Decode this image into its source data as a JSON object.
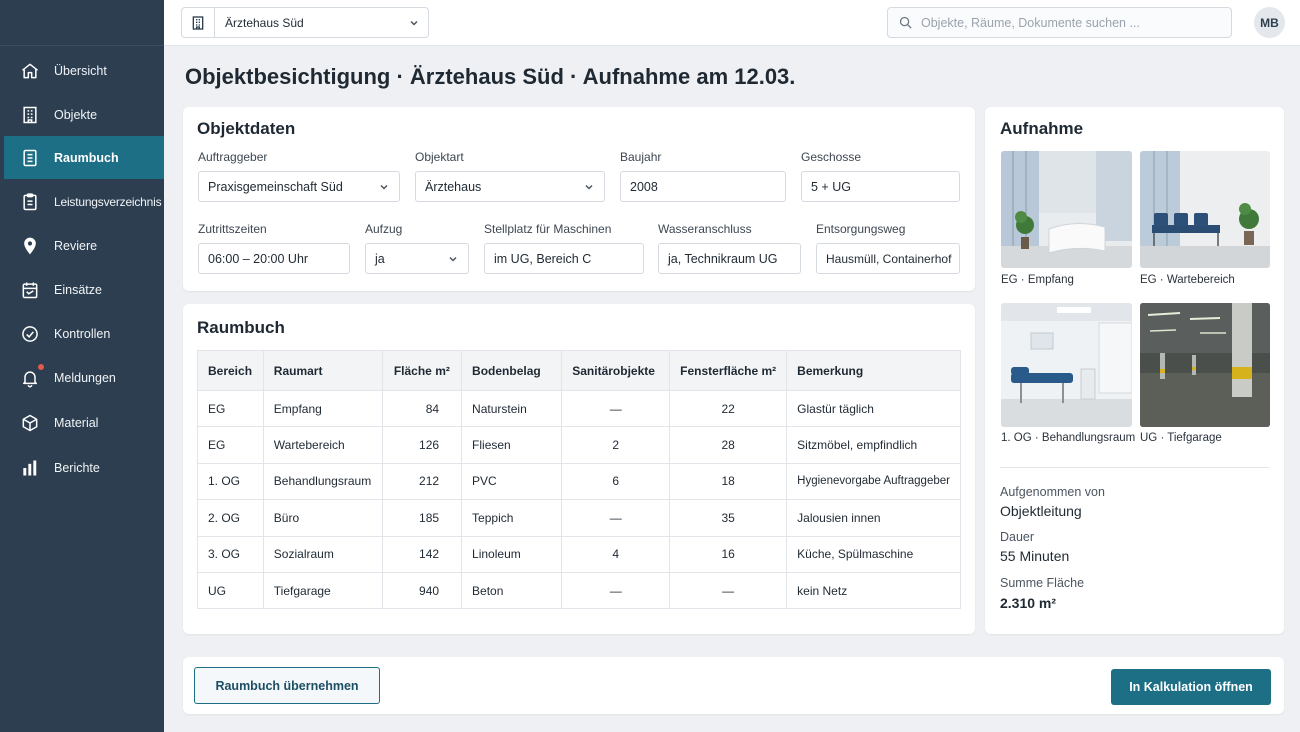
{
  "topbar": {
    "object_select": "Ärztehaus Süd",
    "search_placeholder": "Objekte, Räume, Dokumente suchen ...",
    "avatar": "MB"
  },
  "sidebar": {
    "items": [
      {
        "label": "Übersicht",
        "icon": "home-icon"
      },
      {
        "label": "Objekte",
        "icon": "building-icon"
      },
      {
        "label": "Raumbuch",
        "icon": "document-icon",
        "active": true
      },
      {
        "label": "Leistungsverzeichnis",
        "icon": "clipboard-icon"
      },
      {
        "label": "Reviere",
        "icon": "map-pin-icon"
      },
      {
        "label": "Einsätze",
        "icon": "calendar-icon"
      },
      {
        "label": "Kontrollen",
        "icon": "check-circle-icon"
      },
      {
        "label": "Meldungen",
        "icon": "bell-icon"
      },
      {
        "label": "Material",
        "icon": "box-icon"
      },
      {
        "label": "Berichte",
        "icon": "bar-chart-icon"
      }
    ]
  },
  "page_title": "Objektbesichtigung · Ärztehaus Süd · Aufnahme am 12.03.",
  "objektdaten": {
    "title": "Objektdaten",
    "fields": {
      "auftraggeber": {
        "label": "Auftraggeber",
        "value": "Praxisgemeinschaft Süd"
      },
      "objektart": {
        "label": "Objektart",
        "value": "Ärztehaus"
      },
      "baujahr": {
        "label": "Baujahr",
        "value": "2008"
      },
      "geschosse": {
        "label": "Geschosse",
        "value": "5 + UG"
      },
      "zutrittszeiten": {
        "label": "Zutrittszeiten",
        "value": "06:00 – 20:00 Uhr"
      },
      "aufzug": {
        "label": "Aufzug",
        "value": "ja"
      },
      "stellplatz": {
        "label": "Stellplatz für Maschinen",
        "value": "im UG, Bereich C"
      },
      "wasseranschluss": {
        "label": "Wasseranschluss",
        "value": "ja, Technikraum UG"
      },
      "entsorgungsweg": {
        "label": "Entsorgungsweg",
        "value": "Hausmüll, Containerhof"
      }
    }
  },
  "raumbuch": {
    "title": "Raumbuch",
    "columns": [
      "Bereich",
      "Raumart",
      "Fläche m²",
      "Bodenbelag",
      "Sanitärobjekte",
      "Fensterfläche m²",
      "Bemerkung"
    ],
    "rows": [
      [
        "EG",
        "Empfang",
        "84",
        "Naturstein",
        "—",
        "22",
        "Glastür täglich"
      ],
      [
        "EG",
        "Wartebereich",
        "126",
        "Fliesen",
        "2",
        "28",
        "Sitzmöbel, empfindlich"
      ],
      [
        "1. OG",
        "Behandlungsraum",
        "212",
        "PVC",
        "6",
        "18",
        "Hygienevorgabe Auftraggeber"
      ],
      [
        "2. OG",
        "Büro",
        "185",
        "Teppich",
        "—",
        "35",
        "Jalousien innen"
      ],
      [
        "3. OG",
        "Sozialraum",
        "142",
        "Linoleum",
        "4",
        "16",
        "Küche, Spülmaschine"
      ],
      [
        "UG",
        "Tiefgarage",
        "940",
        "Beton",
        "—",
        "—",
        "kein Netz"
      ]
    ]
  },
  "aufnahme": {
    "title": "Aufnahme",
    "photos": [
      {
        "caption": "EG · Empfang"
      },
      {
        "caption": "EG · Wartebereich"
      },
      {
        "caption": "1. OG · Behandlungsraum"
      },
      {
        "caption": "UG · Tiefgarage"
      }
    ],
    "info": [
      {
        "label": "Aufgenommen von",
        "value": "Objektleitung"
      },
      {
        "label": "Dauer",
        "value": "55 Minuten"
      },
      {
        "label": "Summe Fläche",
        "value": "2.310 m²"
      }
    ]
  },
  "footer": {
    "secondary_button": "Raumbuch übernehmen",
    "primary_button": "In Kalkulation öffnen"
  },
  "colors": {
    "sidebar": "#2c3e50",
    "accent": "#1d6f86"
  }
}
